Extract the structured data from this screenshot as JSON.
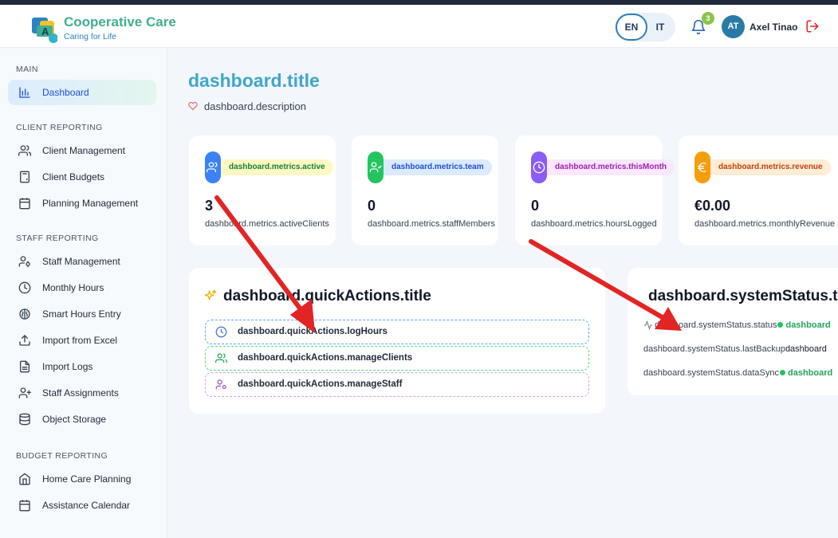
{
  "app": {
    "name": "Cooperative Care",
    "tagline": "Caring for Life"
  },
  "header": {
    "languages": [
      "EN",
      "IT"
    ],
    "active_language": "EN",
    "notification_count": "3",
    "user_initials": "AT",
    "user_name": "Axel Tinao"
  },
  "sidebar": {
    "sections": [
      {
        "title": "MAIN",
        "items": [
          {
            "label": "Dashboard",
            "icon": "bar-chart-icon",
            "active": true
          }
        ]
      },
      {
        "title": "CLIENT REPORTING",
        "items": [
          {
            "label": "Client Management",
            "icon": "users-icon"
          },
          {
            "label": "Client Budgets",
            "icon": "calculator-icon"
          },
          {
            "label": "Planning Management",
            "icon": "calendar-icon"
          }
        ]
      },
      {
        "title": "STAFF REPORTING",
        "items": [
          {
            "label": "Staff Management",
            "icon": "user-cog-icon"
          },
          {
            "label": "Monthly Hours",
            "icon": "clock-icon"
          },
          {
            "label": "Smart Hours Entry",
            "icon": "brain-icon"
          },
          {
            "label": "Import from Excel",
            "icon": "upload-icon"
          },
          {
            "label": "Import Logs",
            "icon": "file-text-icon"
          },
          {
            "label": "Staff Assignments",
            "icon": "user-plus-icon"
          },
          {
            "label": "Object Storage",
            "icon": "database-icon"
          }
        ]
      },
      {
        "title": "BUDGET REPORTING",
        "items": [
          {
            "label": "Home Care Planning",
            "icon": "home-icon"
          },
          {
            "label": "Assistance Calendar",
            "icon": "calendar-icon"
          }
        ]
      }
    ]
  },
  "dashboard": {
    "title": "dashboard.title",
    "description": "dashboard.description",
    "metrics": [
      {
        "pill": "dashboard.metrics.active",
        "value": "3",
        "label": "dashboard.metrics.activeClients",
        "icon": "users-icon",
        "color": "#3b82f6",
        "pill_bg": "#fef9c3",
        "pill_fg": "#15803d"
      },
      {
        "pill": "dashboard.metrics.team",
        "value": "0",
        "label": "dashboard.metrics.staffMembers",
        "icon": "user-check-icon",
        "color": "#22c55e",
        "pill_bg": "#dbeafe",
        "pill_fg": "#1d4ed8"
      },
      {
        "pill": "dashboard.metrics.thisMonth",
        "value": "0",
        "label": "dashboard.metrics.hoursLogged",
        "icon": "clock-icon",
        "color": "#8b5cf6",
        "pill_bg": "#fae8ff",
        "pill_fg": "#a21caf"
      },
      {
        "pill": "dashboard.metrics.revenue",
        "value": "€0.00",
        "label": "dashboard.metrics.monthlyRevenue",
        "icon": "euro-icon",
        "color": "#f59e0b",
        "pill_bg": "#ffedd5",
        "pill_fg": "#c2410c"
      }
    ],
    "quick_actions": {
      "title": "dashboard.quickActions.title",
      "items": [
        {
          "label": "dashboard.quickActions.logHours",
          "icon": "clock-icon",
          "color": "#60a5fa"
        },
        {
          "label": "dashboard.quickActions.manageClients",
          "icon": "users-icon",
          "color": "#4ade80"
        },
        {
          "label": "dashboard.quickActions.manageStaff",
          "icon": "user-cog-icon",
          "color": "#d8a0e6"
        }
      ]
    },
    "system_status": {
      "title": "dashboard.systemStatus.title",
      "status_label": "dashboard.systemStatus.status",
      "status_value": "dashboard",
      "backup_label": "dashboard.systemStatus.lastBackup",
      "backup_value": "dashboard",
      "sync_label": "dashboard.systemStatus.dataSync",
      "sync_value": "dashboard"
    }
  },
  "annotations": {
    "arrow_color": "#e32424"
  }
}
